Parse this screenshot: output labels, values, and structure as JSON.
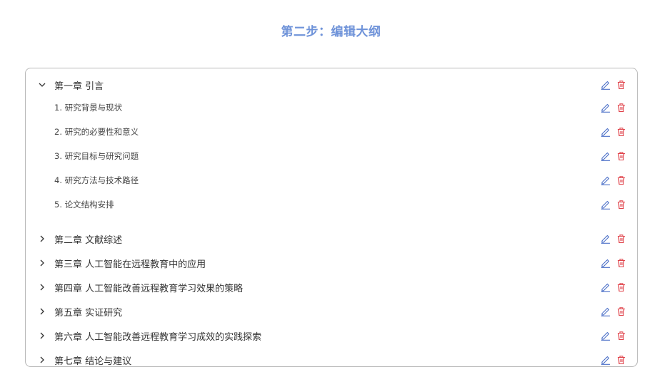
{
  "page": {
    "title": "第二步：编辑大纲"
  },
  "colors": {
    "title": "#6f93d9",
    "edit_icon": "#4a6fc7",
    "delete_icon": "#e0424a",
    "border": "#b8b8b8"
  },
  "icons": {
    "expanded": "chevron-down-icon",
    "collapsed": "chevron-right-icon",
    "edit": "pencil-icon",
    "delete": "trash-icon"
  },
  "outline": {
    "chapter1": {
      "label": "第一章 引言",
      "expanded": true,
      "sections": [
        {
          "label": "1. 研究背景与现状"
        },
        {
          "label": "2. 研究的必要性和意义"
        },
        {
          "label": "3. 研究目标与研究问题"
        },
        {
          "label": "4. 研究方法与技术路径"
        },
        {
          "label": "5. 论文结构安排"
        }
      ]
    },
    "chapters": [
      {
        "label": "第二章 文献综述",
        "expanded": false
      },
      {
        "label": "第三章 人工智能在远程教育中的应用",
        "expanded": false
      },
      {
        "label": "第四章 人工智能改善远程教育学习效果的策略",
        "expanded": false
      },
      {
        "label": "第五章 实证研究",
        "expanded": false
      },
      {
        "label": "第六章 人工智能改善远程教育学习成效的实践探索",
        "expanded": false
      },
      {
        "label": "第七章 结论与建议",
        "expanded": false
      }
    ]
  }
}
